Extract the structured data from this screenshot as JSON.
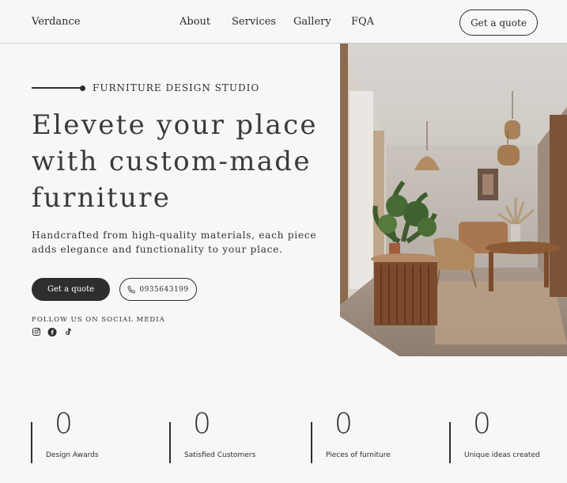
{
  "header": {
    "logo": "Verdance",
    "nav": [
      "About",
      "Services",
      "Gallery",
      "FQA"
    ],
    "cta": "Get a quote"
  },
  "hero": {
    "eyebrow": "FURNITURE DESIGN STUDIO",
    "title": "Elevete your place with custom-made furniture",
    "description": "Handcrafted from high-quality materials, each piece adds elegance and functionality to your place.",
    "primary_button": "Get a quote",
    "phone": "0935643199",
    "follow": "FOLLOW US ON SOCIAL MEDIA",
    "socials": [
      "instagram-icon",
      "facebook-icon",
      "tiktok-icon"
    ]
  },
  "stats": [
    {
      "value": "0",
      "label": "Design Awards"
    },
    {
      "value": "0",
      "label": "Satisfied Customers"
    },
    {
      "value": "0",
      "label": "Pieces of furniture"
    },
    {
      "value": "0",
      "label": "Unique ideas created"
    }
  ],
  "colors": {
    "background": "#f7f7f7",
    "text": "#2e2e2e",
    "button_dark": "#2e2e2e"
  }
}
